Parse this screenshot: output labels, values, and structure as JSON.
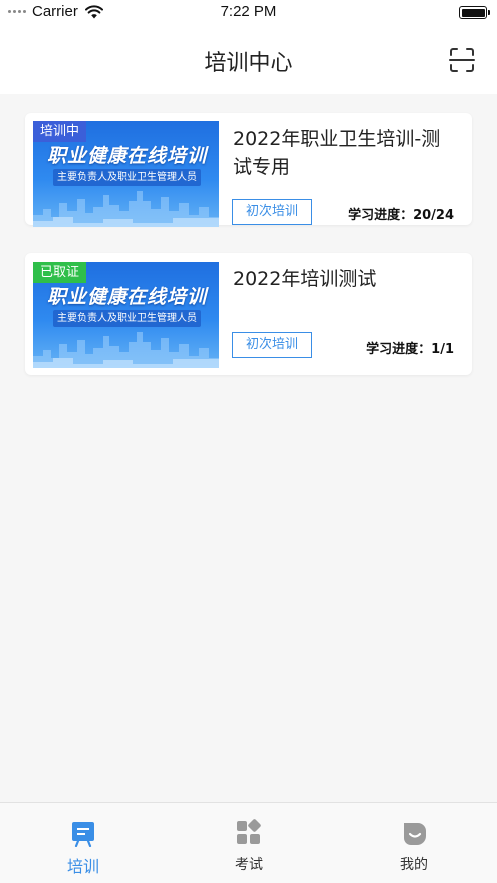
{
  "status_bar": {
    "carrier": "Carrier",
    "time": "7:22 PM"
  },
  "nav": {
    "title": "培训中心",
    "scan_icon": "scan-icon"
  },
  "thumbnail": {
    "title": "职业健康在线培训",
    "subtitle": "主要负责人及职业卫生管理人员"
  },
  "courses": [
    {
      "status": "培训中",
      "status_color": "#3b5fd9",
      "title": "2022年职业卫生培训-测试专用",
      "tag": "初次培训",
      "progress": "学习进度：20/24"
    },
    {
      "status": "已取证",
      "status_color": "#2fbf4a",
      "title": "2022年培训测试",
      "tag": "初次培训",
      "progress": "学习进度：1/1"
    }
  ],
  "tabs": [
    {
      "label": "培训",
      "icon": "training-board-icon",
      "active": true
    },
    {
      "label": "考试",
      "icon": "exam-grid-icon",
      "active": false
    },
    {
      "label": "我的",
      "icon": "profile-icon",
      "active": false
    }
  ],
  "colors": {
    "accent": "#3a8ee6"
  }
}
